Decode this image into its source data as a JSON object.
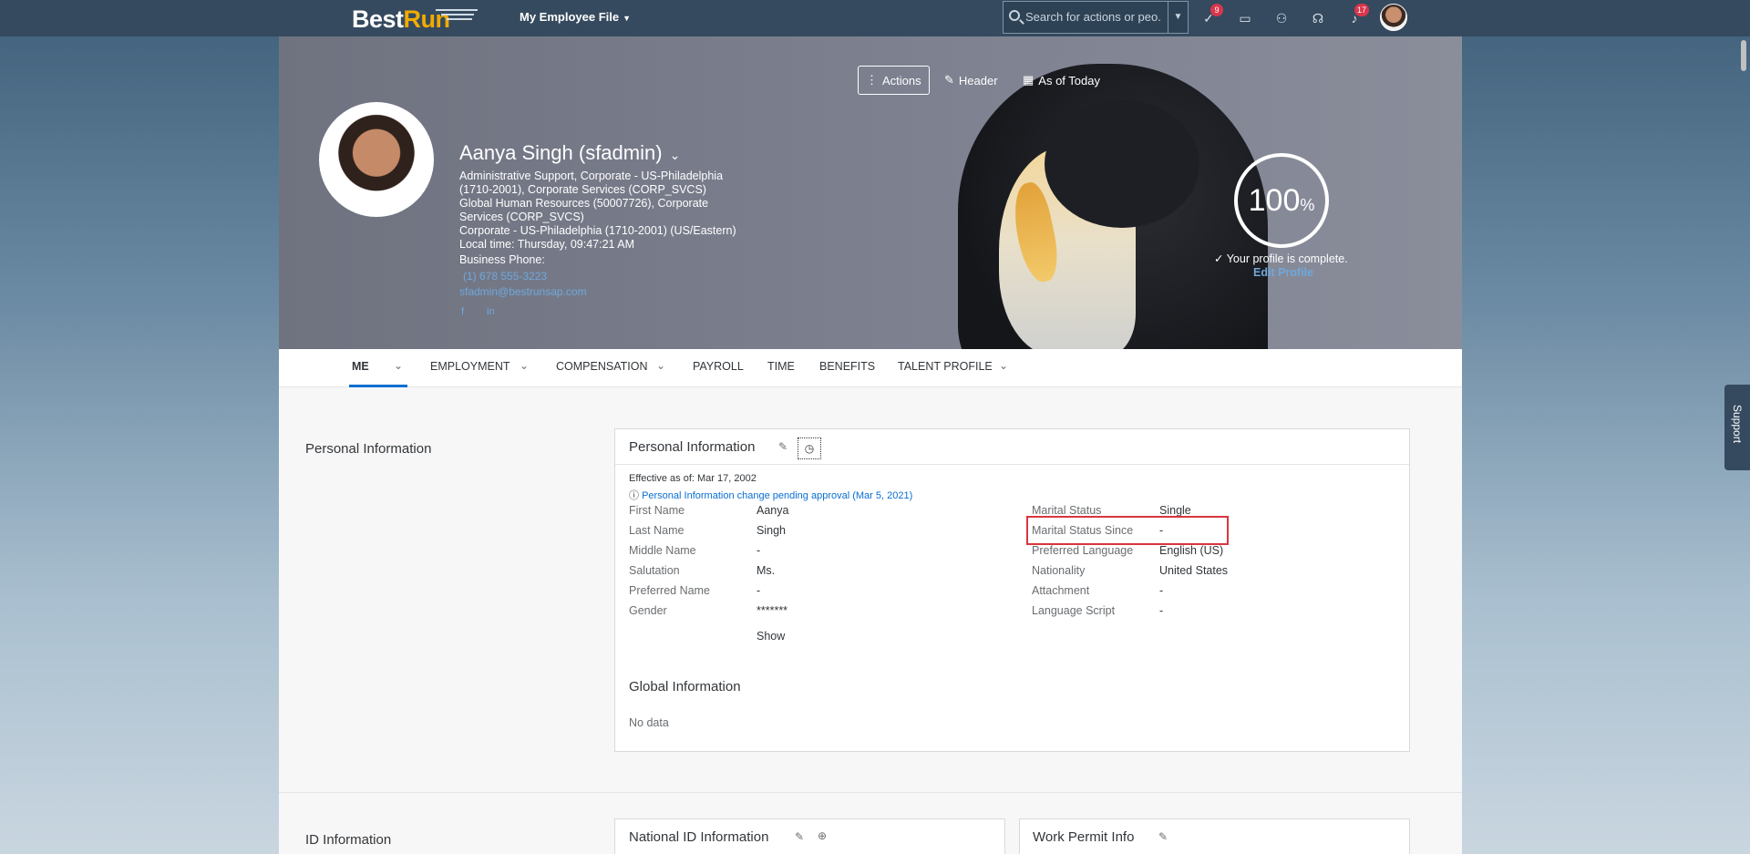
{
  "shell": {
    "logo_best": "Best",
    "logo_run": "Run",
    "app_title": "My Employee File",
    "search_placeholder": "Search for actions or peo...",
    "icons": [
      {
        "name": "approvals-icon",
        "badge": "9"
      },
      {
        "name": "chat-icon",
        "badge": ""
      },
      {
        "name": "people-icon",
        "badge": ""
      },
      {
        "name": "headset-icon",
        "badge": ""
      },
      {
        "name": "notifications-icon",
        "badge": "17"
      }
    ]
  },
  "header": {
    "actions_label": "Actions",
    "header_label": "Header",
    "date_label": "As of Today",
    "name": "Aanya Singh (sfadmin)",
    "lines": [
      "Administrative Support, Corporate - US-Philadelphia",
      "(1710-2001), Corporate Services (CORP_SVCS)",
      "Global Human Resources (50007726), Corporate",
      "Services (CORP_SVCS)",
      "Corporate - US-Philadelphia (1710-2001) (US/Eastern)",
      "Local time: Thursday, 09:47:21 AM"
    ],
    "phone_label": "Business Phone:",
    "phone": "(1) 678 555-3223",
    "email": "sfadmin@bestrunsap.com",
    "profile_percent": "100",
    "percent_sign": "%",
    "complete_text": "Your profile is complete.",
    "edit_profile": "Edit Profile"
  },
  "tabs": [
    {
      "label": "ME",
      "has_menu": true
    },
    {
      "label": "EMPLOYMENT",
      "has_menu": true
    },
    {
      "label": "COMPENSATION",
      "has_menu": true
    },
    {
      "label": "PAYROLL",
      "has_menu": false
    },
    {
      "label": "TIME",
      "has_menu": false
    },
    {
      "label": "BENEFITS",
      "has_menu": false
    },
    {
      "label": "TALENT PROFILE",
      "has_menu": true
    }
  ],
  "personal": {
    "section_title": "Personal Information",
    "card_title": "Personal Information",
    "effective": "Effective as of: Mar 17, 2002",
    "pending": "Personal Information change pending approval (Mar 5, 2021)",
    "left_fields": [
      {
        "label": "First Name",
        "value": "Aanya"
      },
      {
        "label": "Last Name",
        "value": "Singh"
      },
      {
        "label": "Middle Name",
        "value": "-"
      },
      {
        "label": "Salutation",
        "value": "Ms."
      },
      {
        "label": "Preferred Name",
        "value": "-"
      },
      {
        "label": "Gender",
        "value": "*******"
      }
    ],
    "right_fields": [
      {
        "label": "Marital Status",
        "value": "Single"
      },
      {
        "label": "Marital Status Since",
        "value": "-"
      },
      {
        "label": "Preferred Language",
        "value": "English (US)"
      },
      {
        "label": "Nationality",
        "value": "United States"
      },
      {
        "label": "Attachment",
        "value": "-"
      },
      {
        "label": "Language Script",
        "value": "-"
      }
    ],
    "show_link": "Show",
    "global_title": "Global Information",
    "global_empty": "No data"
  },
  "id_info": {
    "section_title": "ID Information",
    "national_title": "National ID Information",
    "work_permit_title": "Work Permit Info"
  },
  "support_label": "Support",
  "colors": {
    "shell": "#354a5f",
    "accent": "#0a6ed1",
    "highlight": "#d9363e"
  }
}
